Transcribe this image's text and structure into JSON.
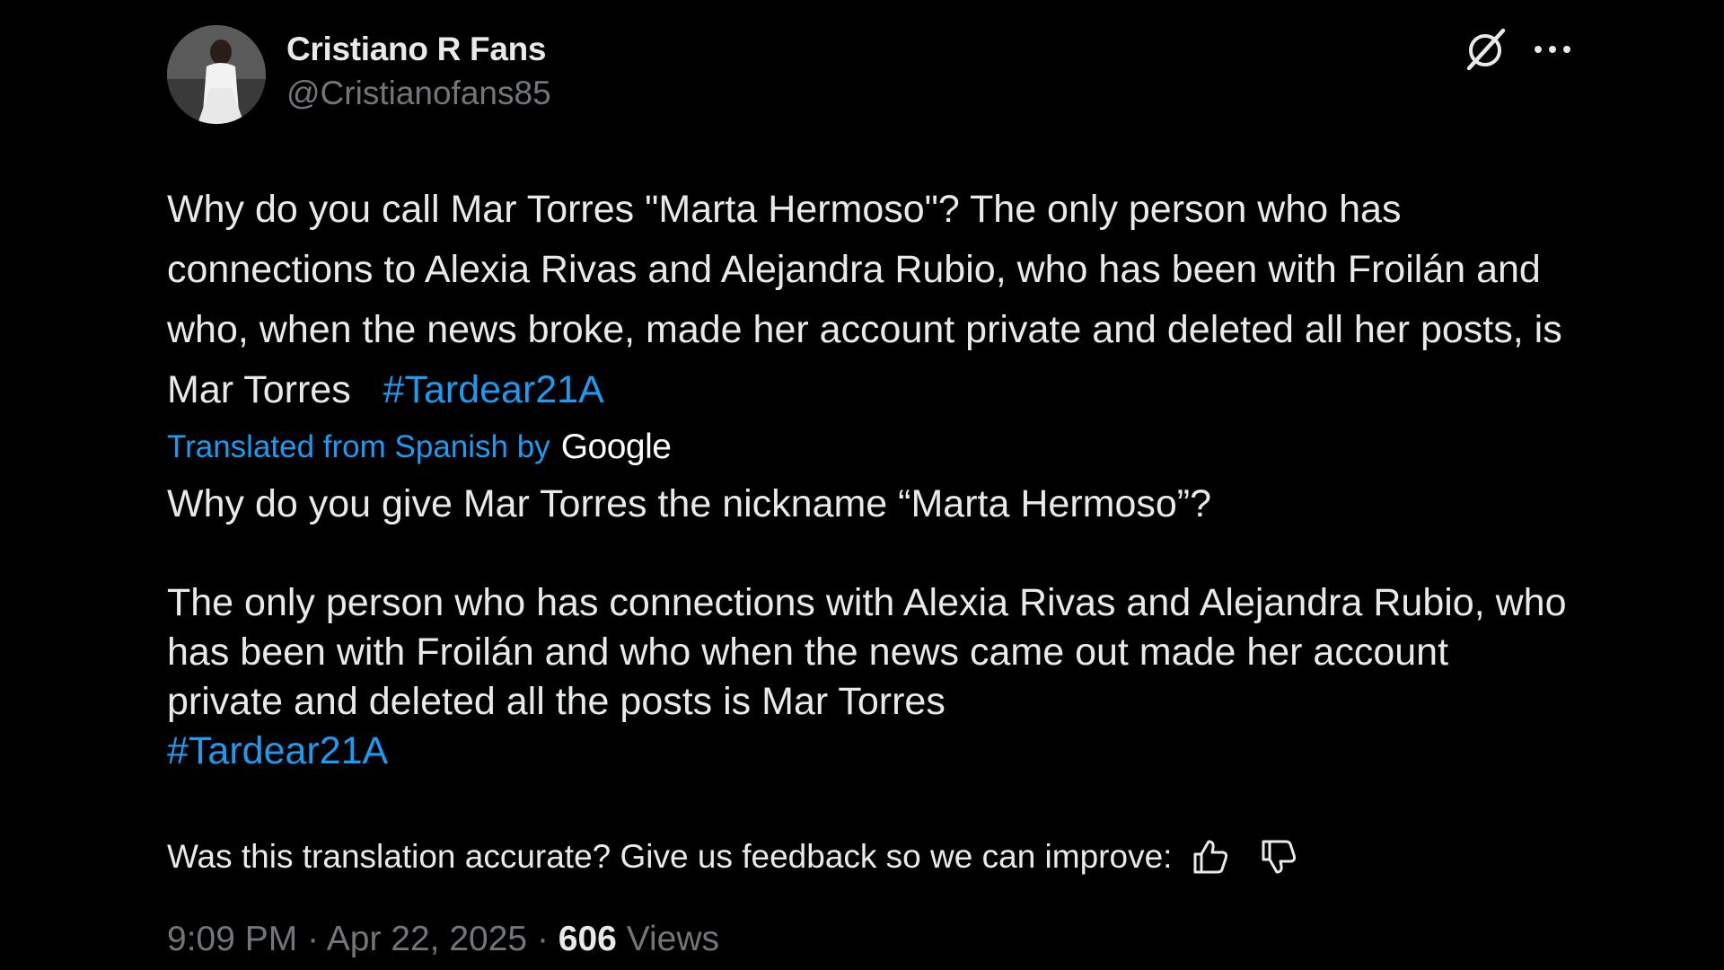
{
  "author": {
    "display_name": "Cristiano R Fans",
    "handle": "@Cristianofans85",
    "avatar_icon": "avatar-photo"
  },
  "actions": {
    "grok_icon": "grok-icon",
    "more_icon": "more-icon"
  },
  "original": {
    "text": "Why do you call Mar Torres \"Marta Hermoso\"? The only person who has connections to Alexia Rivas and Alejandra Rubio, who has been with Froilán and who, when the news broke, made her account private and deleted all her posts, is Mar Torres",
    "hashtag": "#Tardear21A"
  },
  "translation_attribution": {
    "label": "Translated from Spanish by",
    "provider": "Google"
  },
  "translation": {
    "paragraph1": "Why do you give Mar Torres the nickname “Marta Hermoso”?",
    "paragraph2": "The only person who has connections with Alexia Rivas and Alejandra Rubio, who has been with Froilán and who when the news came out made her account private and deleted all the posts is Mar Torres",
    "hashtag": "#Tardear21A"
  },
  "feedback": {
    "prompt": "Was this translation accurate? Give us feedback so we can improve:",
    "thumbs_up_icon": "thumbs-up-icon",
    "thumbs_down_icon": "thumbs-down-icon"
  },
  "meta": {
    "time": "9:09 PM",
    "separator": " · ",
    "date": "Apr 22, 2025",
    "views_count": "606",
    "views_label": "Views"
  },
  "colors": {
    "background": "#000000",
    "text": "#e7e9ea",
    "muted": "#71767b",
    "link": "#1d9bf0"
  }
}
